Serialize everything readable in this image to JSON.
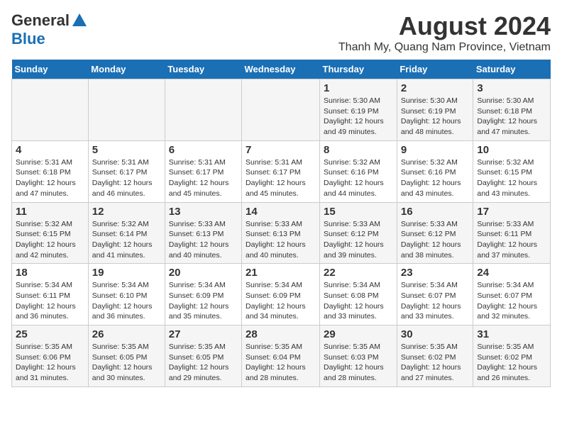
{
  "logo": {
    "general": "General",
    "blue": "Blue"
  },
  "title": "August 2024",
  "subtitle": "Thanh My, Quang Nam Province, Vietnam",
  "days_of_week": [
    "Sunday",
    "Monday",
    "Tuesday",
    "Wednesday",
    "Thursday",
    "Friday",
    "Saturday"
  ],
  "weeks": [
    [
      {
        "day": "",
        "detail": ""
      },
      {
        "day": "",
        "detail": ""
      },
      {
        "day": "",
        "detail": ""
      },
      {
        "day": "",
        "detail": ""
      },
      {
        "day": "1",
        "detail": "Sunrise: 5:30 AM\nSunset: 6:19 PM\nDaylight: 12 hours\nand 49 minutes."
      },
      {
        "day": "2",
        "detail": "Sunrise: 5:30 AM\nSunset: 6:19 PM\nDaylight: 12 hours\nand 48 minutes."
      },
      {
        "day": "3",
        "detail": "Sunrise: 5:30 AM\nSunset: 6:18 PM\nDaylight: 12 hours\nand 47 minutes."
      }
    ],
    [
      {
        "day": "4",
        "detail": "Sunrise: 5:31 AM\nSunset: 6:18 PM\nDaylight: 12 hours\nand 47 minutes."
      },
      {
        "day": "5",
        "detail": "Sunrise: 5:31 AM\nSunset: 6:17 PM\nDaylight: 12 hours\nand 46 minutes."
      },
      {
        "day": "6",
        "detail": "Sunrise: 5:31 AM\nSunset: 6:17 PM\nDaylight: 12 hours\nand 45 minutes."
      },
      {
        "day": "7",
        "detail": "Sunrise: 5:31 AM\nSunset: 6:17 PM\nDaylight: 12 hours\nand 45 minutes."
      },
      {
        "day": "8",
        "detail": "Sunrise: 5:32 AM\nSunset: 6:16 PM\nDaylight: 12 hours\nand 44 minutes."
      },
      {
        "day": "9",
        "detail": "Sunrise: 5:32 AM\nSunset: 6:16 PM\nDaylight: 12 hours\nand 43 minutes."
      },
      {
        "day": "10",
        "detail": "Sunrise: 5:32 AM\nSunset: 6:15 PM\nDaylight: 12 hours\nand 43 minutes."
      }
    ],
    [
      {
        "day": "11",
        "detail": "Sunrise: 5:32 AM\nSunset: 6:15 PM\nDaylight: 12 hours\nand 42 minutes."
      },
      {
        "day": "12",
        "detail": "Sunrise: 5:32 AM\nSunset: 6:14 PM\nDaylight: 12 hours\nand 41 minutes."
      },
      {
        "day": "13",
        "detail": "Sunrise: 5:33 AM\nSunset: 6:13 PM\nDaylight: 12 hours\nand 40 minutes."
      },
      {
        "day": "14",
        "detail": "Sunrise: 5:33 AM\nSunset: 6:13 PM\nDaylight: 12 hours\nand 40 minutes."
      },
      {
        "day": "15",
        "detail": "Sunrise: 5:33 AM\nSunset: 6:12 PM\nDaylight: 12 hours\nand 39 minutes."
      },
      {
        "day": "16",
        "detail": "Sunrise: 5:33 AM\nSunset: 6:12 PM\nDaylight: 12 hours\nand 38 minutes."
      },
      {
        "day": "17",
        "detail": "Sunrise: 5:33 AM\nSunset: 6:11 PM\nDaylight: 12 hours\nand 37 minutes."
      }
    ],
    [
      {
        "day": "18",
        "detail": "Sunrise: 5:34 AM\nSunset: 6:11 PM\nDaylight: 12 hours\nand 36 minutes."
      },
      {
        "day": "19",
        "detail": "Sunrise: 5:34 AM\nSunset: 6:10 PM\nDaylight: 12 hours\nand 36 minutes."
      },
      {
        "day": "20",
        "detail": "Sunrise: 5:34 AM\nSunset: 6:09 PM\nDaylight: 12 hours\nand 35 minutes."
      },
      {
        "day": "21",
        "detail": "Sunrise: 5:34 AM\nSunset: 6:09 PM\nDaylight: 12 hours\nand 34 minutes."
      },
      {
        "day": "22",
        "detail": "Sunrise: 5:34 AM\nSunset: 6:08 PM\nDaylight: 12 hours\nand 33 minutes."
      },
      {
        "day": "23",
        "detail": "Sunrise: 5:34 AM\nSunset: 6:07 PM\nDaylight: 12 hours\nand 33 minutes."
      },
      {
        "day": "24",
        "detail": "Sunrise: 5:34 AM\nSunset: 6:07 PM\nDaylight: 12 hours\nand 32 minutes."
      }
    ],
    [
      {
        "day": "25",
        "detail": "Sunrise: 5:35 AM\nSunset: 6:06 PM\nDaylight: 12 hours\nand 31 minutes."
      },
      {
        "day": "26",
        "detail": "Sunrise: 5:35 AM\nSunset: 6:05 PM\nDaylight: 12 hours\nand 30 minutes."
      },
      {
        "day": "27",
        "detail": "Sunrise: 5:35 AM\nSunset: 6:05 PM\nDaylight: 12 hours\nand 29 minutes."
      },
      {
        "day": "28",
        "detail": "Sunrise: 5:35 AM\nSunset: 6:04 PM\nDaylight: 12 hours\nand 28 minutes."
      },
      {
        "day": "29",
        "detail": "Sunrise: 5:35 AM\nSunset: 6:03 PM\nDaylight: 12 hours\nand 28 minutes."
      },
      {
        "day": "30",
        "detail": "Sunrise: 5:35 AM\nSunset: 6:02 PM\nDaylight: 12 hours\nand 27 minutes."
      },
      {
        "day": "31",
        "detail": "Sunrise: 5:35 AM\nSunset: 6:02 PM\nDaylight: 12 hours\nand 26 minutes."
      }
    ]
  ]
}
